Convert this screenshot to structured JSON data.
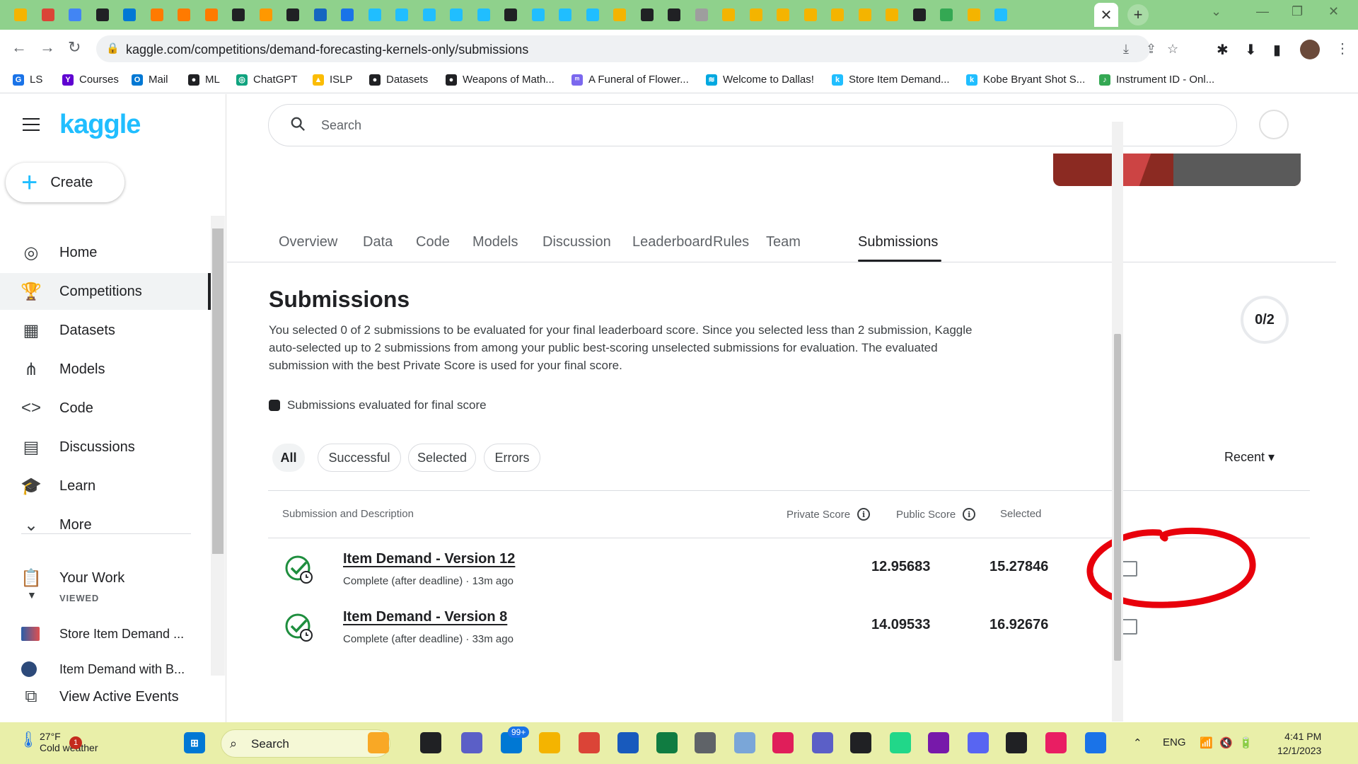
{
  "browser": {
    "url": "kaggle.com/competitions/demand-forecasting-kernels-only/submissions",
    "tab_close": "✕",
    "new_tab": "+",
    "bookmarks": [
      {
        "label": "LS",
        "color": "#1a73e8",
        "glyph": "G"
      },
      {
        "label": "Courses",
        "color": "#5f01d1",
        "glyph": "Y"
      },
      {
        "label": "Mail",
        "color": "#0078d4",
        "glyph": "O"
      },
      {
        "label": "ML",
        "color": "#202124",
        "glyph": "●"
      },
      {
        "label": "ChatGPT",
        "color": "#10a37f",
        "glyph": "◎"
      },
      {
        "label": "ISLP",
        "color": "#fbbc04",
        "glyph": "▲"
      },
      {
        "label": "Datasets",
        "color": "#202124",
        "glyph": "●"
      },
      {
        "label": "Weapons of Math...",
        "color": "#202124",
        "glyph": "●"
      },
      {
        "label": "A Funeral of Flower...",
        "color": "#7b68ee",
        "glyph": "ᵐ"
      },
      {
        "label": "Welcome to Dallas!",
        "color": "#00a8e0",
        "glyph": "≋"
      },
      {
        "label": "Store Item Demand...",
        "color": "#20beff",
        "glyph": "k"
      },
      {
        "label": "Kobe Bryant Shot S...",
        "color": "#20beff",
        "glyph": "k"
      },
      {
        "label": "Instrument ID - Onl...",
        "color": "#34a853",
        "glyph": "♪"
      }
    ]
  },
  "sidebar": {
    "create_label": "Create",
    "items": [
      {
        "label": "Home",
        "icon": "compass-icon",
        "glyph": "◎"
      },
      {
        "label": "Competitions",
        "icon": "trophy-icon",
        "glyph": "🏆"
      },
      {
        "label": "Datasets",
        "icon": "table-icon",
        "glyph": "▦"
      },
      {
        "label": "Models",
        "icon": "models-icon",
        "glyph": "⋔"
      },
      {
        "label": "Code",
        "icon": "code-icon",
        "glyph": "<>"
      },
      {
        "label": "Discussions",
        "icon": "discussions-icon",
        "glyph": "▤"
      },
      {
        "label": "Learn",
        "icon": "graduation-cap-icon",
        "glyph": "🎓"
      },
      {
        "label": "More",
        "icon": "chevron-down-icon",
        "glyph": "⌄"
      }
    ],
    "your_work": "Your Work",
    "viewed_label": "VIEWED",
    "viewed_items": [
      "Store Item Demand ...",
      "Item Demand with B..."
    ],
    "view_active_events": "View Active Events"
  },
  "search": {
    "placeholder": "Search"
  },
  "tabs": [
    "Overview",
    "Data",
    "Code",
    "Models",
    "Discussion",
    "Leaderboard",
    "Rules",
    "Team",
    "Submissions"
  ],
  "submissions": {
    "title": "Submissions",
    "description": "You selected 0 of 2 submissions to be evaluated for your final leaderboard score. Since you selected less than 2 submission, Kaggle auto-selected up to 2 submissions from among your public best-scoring unselected submissions for evaluation. The evaluated submission with the best Private Score is used for your final score.",
    "counter": "0/2",
    "legend": "Submissions evaluated for final score",
    "filters": [
      "All",
      "Successful",
      "Selected",
      "Errors"
    ],
    "sort": "Recent ▾",
    "columns": {
      "description": "Submission and Description",
      "private": "Private Score",
      "public": "Public Score",
      "selected": "Selected"
    },
    "rows": [
      {
        "name": "Item Demand - Version 12",
        "status": "Complete (after deadline) · 13m ago",
        "private": "12.95683",
        "public": "15.27846"
      },
      {
        "name": "Item Demand - Version 8",
        "status": "Complete (after deadline) · 33m ago",
        "private": "14.09533",
        "public": "16.92676"
      }
    ]
  },
  "taskbar": {
    "temp": "27°F",
    "weather": "Cold weather",
    "weather_badge": "1",
    "search_placeholder": "Search",
    "mail_badge": "99+",
    "lang": "ENG",
    "time": "4:41 PM",
    "date": "12/1/2023"
  },
  "colors": {
    "kaggle_blue": "#20beff",
    "annotation_red": "#e8000b",
    "tabstrip_green": "#8fd18c",
    "taskbar_yellow": "#e9efa9"
  }
}
